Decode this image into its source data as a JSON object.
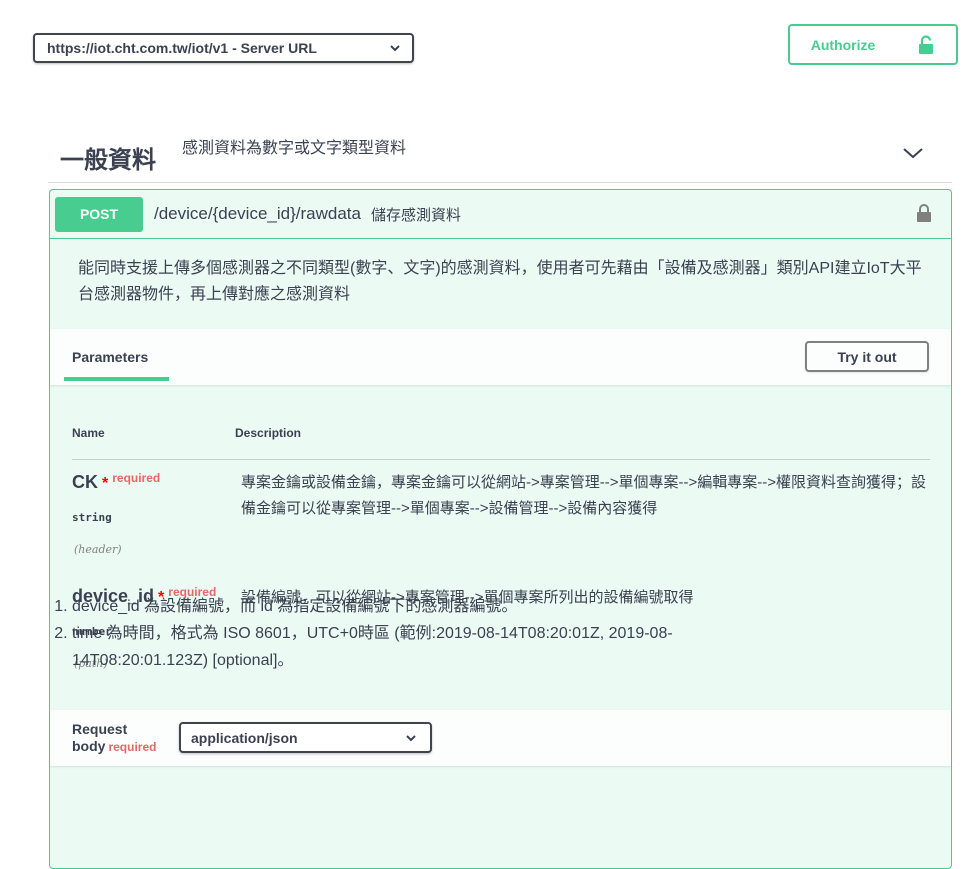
{
  "server": {
    "selected": "https://iot.cht.com.tw/iot/v1 - Server URL"
  },
  "authorize": {
    "label": "Authorize"
  },
  "tag": {
    "title": "一般資料",
    "description": "感測資料為數字或文字類型資料"
  },
  "operation": {
    "method": "POST",
    "path": "/device/{device_id}/rawdata",
    "summary": "儲存感測資料",
    "description": "能同時支援上傳多個感測器之不同類型(數字、文字)的感測資料，使用者可先藉由「設備及感測器」類別API建立IoT大平台感測器物件，再上傳對應之感測資料"
  },
  "parameters": {
    "tab_label": "Parameters",
    "try_label": "Try it out",
    "col_name": "Name",
    "col_description": "Description",
    "items": [
      {
        "name": "CK",
        "star": "*",
        "required": "required",
        "type": "string",
        "in": "(header)",
        "description": "專案金鑰或設備金鑰，專案金鑰可以從網站->專案管理-->單個專案-->編輯專案-->權限資料查詢獲得；設備金鑰可以從專案管理-->單個專案-->設備管理-->設備內容獲得"
      },
      {
        "name": "device_id",
        "star": "*",
        "required": "required",
        "type": "number",
        "in": "(path)",
        "description": "設備編號，可以從網站->專案管理-->單個專案所列出的設備編號取得"
      }
    ]
  },
  "request_body": {
    "label_line1": "Request",
    "label_line2": "body",
    "required": "required",
    "content_type": "application/json",
    "notes": [
      "device_id 為設備編號，而 id 為指定設備編號下的感測器編號。",
      "time 為時間，格式為 ISO 8601，UTC+0時區 (範例:2019-08-14T08:20:01Z, 2019-08-14T08:20:01.123Z) [optional]。"
    ]
  },
  "colors": {
    "post": "#49cc90",
    "text": "#3b4151",
    "required": "#e56767"
  }
}
